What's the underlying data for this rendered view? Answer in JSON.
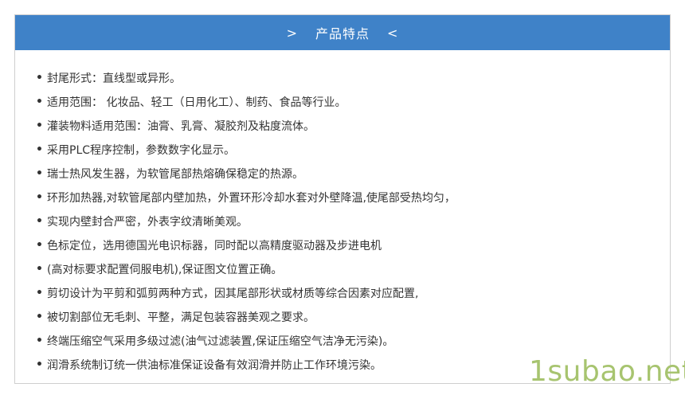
{
  "header": {
    "title": "产品特点",
    "left_symbol": ">",
    "right_symbol": "<",
    "background": "#3f82c8"
  },
  "bullet": "•",
  "features": [
    "封尾形式：直线型或异形。",
    "适用范围： 化妆品、轻工（日用化工）、制药、食品等行业。",
    "灌装物料适用范围：油膏、乳膏、凝胶剂及粘度流体。",
    "采用PLC程序控制，参数数字化显示。",
    "瑞士热风发生器，为软管尾部热熔确保稳定的热源。",
    "环形加热器,对软管尾部内壁加热，外置环形冷却水套对外壁降温,使尾部受热均匀，",
    "实现内壁封合严密，外表字纹清晰美观。",
    "色标定位，选用德国光电识标器，同时配以高精度驱动器及步进电机",
    "(高对标要求配置伺服电机),保证图文位置正确。",
    "剪切设计为平剪和弧剪两种方式，因其尾部形状或材质等综合因素对应配置,",
    "被切割部位无毛刺、平整，满足包装容器美观之要求。",
    "终端压缩空气采用多级过滤(油气过滤装置,保证压缩空气洁净无污染)。",
    "润滑系统制订统一供油标准保证设备有效润滑并防止工作环境污染。"
  ],
  "watermark": "1subao.net",
  "watermark_color": "#a7c46f"
}
